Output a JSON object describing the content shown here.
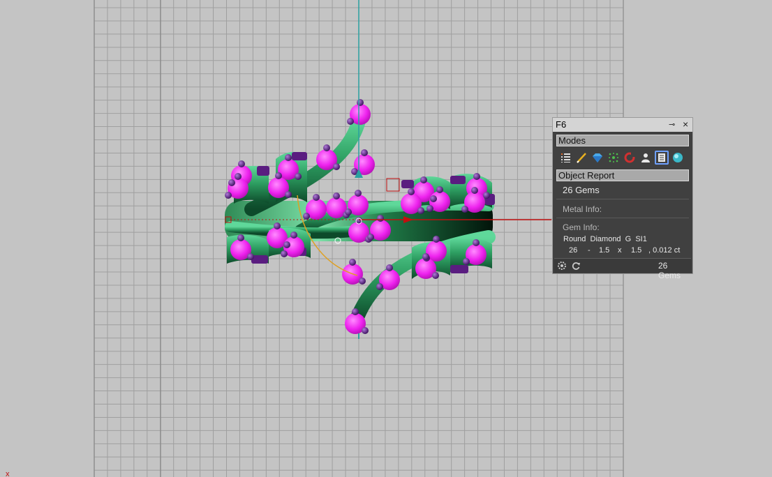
{
  "panel": {
    "title": "F6",
    "pin_glyph": "⊸",
    "close_glyph": "×",
    "modes_header": "Modes",
    "mode_icons": [
      "list-icon",
      "pencil-icon",
      "diamond-icon",
      "sparkle-icon",
      "magnet-icon",
      "person-icon",
      "report-icon",
      "sphere-icon"
    ],
    "selected_mode": "report-icon",
    "object_report_header": "Object Report",
    "gem_count_title": "26 Gems",
    "metal_info_label": "Metal Info:",
    "gem_info_label": "Gem Info:",
    "gem_desc": "Round  Diamond  G  SI1",
    "gem_qty": "26",
    "gem_dash": "-",
    "gem_w": "1.5",
    "gem_x": "x",
    "gem_h": "1.5",
    "gem_ct": ", 0.012 ct",
    "footer_count": "26 Gems"
  },
  "viewport": {
    "background": "#c4c4c4",
    "grid_color": "#9f9f9f",
    "ring_color": "#2e8f58",
    "gem_color": "#ee22ee",
    "prong_color": "#5a1d80",
    "axis_red": "#c01010",
    "axis_teal": "#2aa0a0"
  }
}
